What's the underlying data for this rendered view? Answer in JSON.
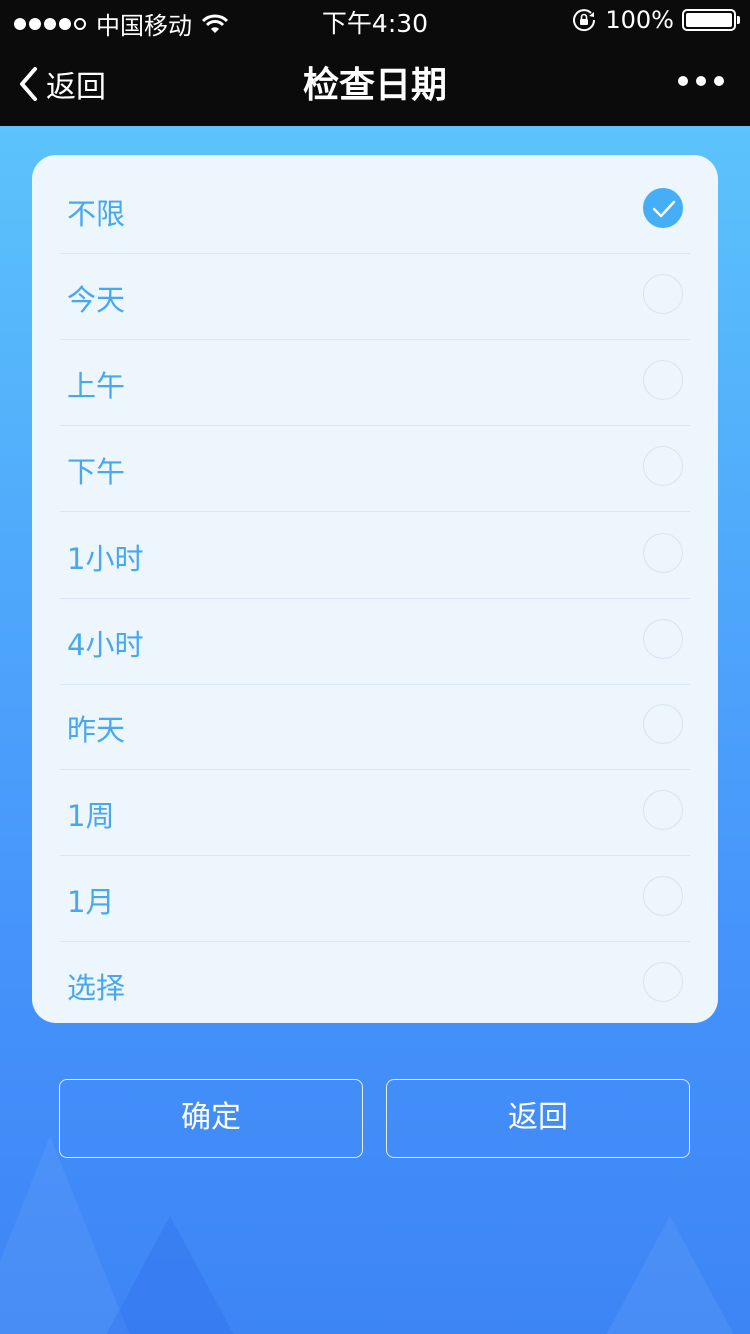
{
  "status_bar": {
    "carrier": "中国移动",
    "time": "下午4:30",
    "battery": "100%",
    "battery_level": 1.0,
    "icons": [
      "signal-dots-icon",
      "wifi-icon",
      "rotation-lock-icon",
      "battery-icon"
    ]
  },
  "nav": {
    "back_label": "返回",
    "title": "检查日期"
  },
  "options": [
    {
      "label": "不限",
      "selected": true
    },
    {
      "label": "今天",
      "selected": false
    },
    {
      "label": "上午",
      "selected": false
    },
    {
      "label": "下午",
      "selected": false
    },
    {
      "label": "1小时",
      "selected": false
    },
    {
      "label": "4小时",
      "selected": false
    },
    {
      "label": "昨天",
      "selected": false
    },
    {
      "label": "1周",
      "selected": false
    },
    {
      "label": "1月",
      "selected": false
    },
    {
      "label": "选择",
      "selected": false
    }
  ],
  "buttons": {
    "confirm_label": "确定",
    "back_label": "返回"
  },
  "colors": {
    "accent": "#46aef6",
    "label": "#47a8ee",
    "bar": "#0b0b0c"
  }
}
